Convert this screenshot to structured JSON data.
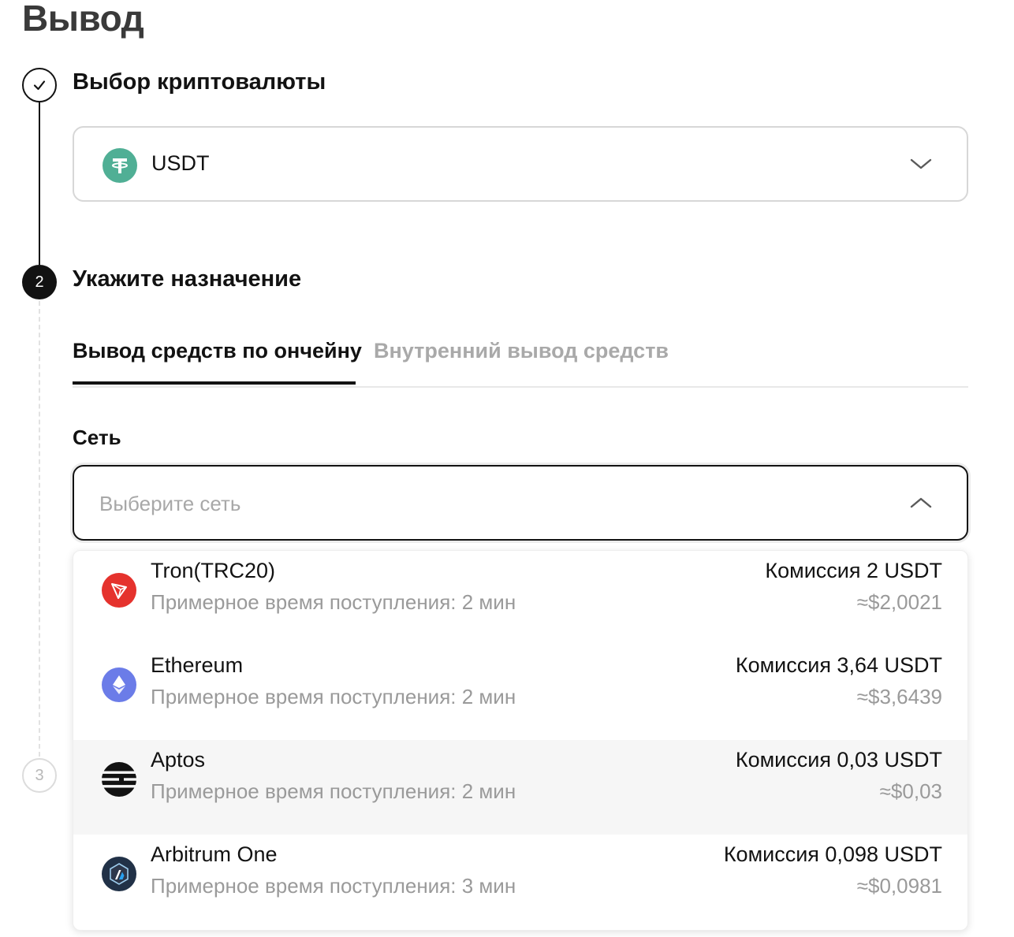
{
  "page": {
    "title": "Вывод"
  },
  "steps": [
    {
      "label": "Выбор криптовалюты",
      "state": "completed",
      "icon": "check-icon"
    },
    {
      "label": "Укажите назначение",
      "number": "2",
      "state": "active"
    },
    {
      "number": "3",
      "state": "upcoming"
    }
  ],
  "crypto_select": {
    "value": "USDT",
    "icon": "tether-icon",
    "icon_color": "#50af95"
  },
  "tabs": [
    {
      "label": "Вывод средств по ончейну",
      "active": true
    },
    {
      "label": "Внутренний вывод средств",
      "active": false
    }
  ],
  "network_field": {
    "label": "Сеть",
    "placeholder": "Выберите сеть",
    "expanded": true
  },
  "networks": [
    {
      "name": "Tron(TRC20)",
      "eta": "Примерное время поступления: 2 мин",
      "fee": "Комиссия 2 USDT",
      "usd": "≈$2,0021",
      "icon": "tron-icon",
      "icon_color": "#e5322d"
    },
    {
      "name": "Ethereum",
      "eta": "Примерное время поступления: 2 мин",
      "fee": "Комиссия 3,64 USDT",
      "usd": "≈$3,6439",
      "icon": "ethereum-icon",
      "icon_color": "#6b7ce8"
    },
    {
      "name": "Aptos",
      "eta": "Примерное время поступления: 2 мин",
      "fee": "Комиссия 0,03 USDT",
      "usd": "≈$0,03",
      "icon": "aptos-icon",
      "icon_color": "#121212",
      "hovered": true
    },
    {
      "name": "Arbitrum One",
      "eta": "Примерное время поступления: 3 мин",
      "fee": "Комиссия 0,098 USDT",
      "usd": "≈$0,0981",
      "icon": "arbitrum-icon",
      "icon_color": "#213147"
    }
  ]
}
